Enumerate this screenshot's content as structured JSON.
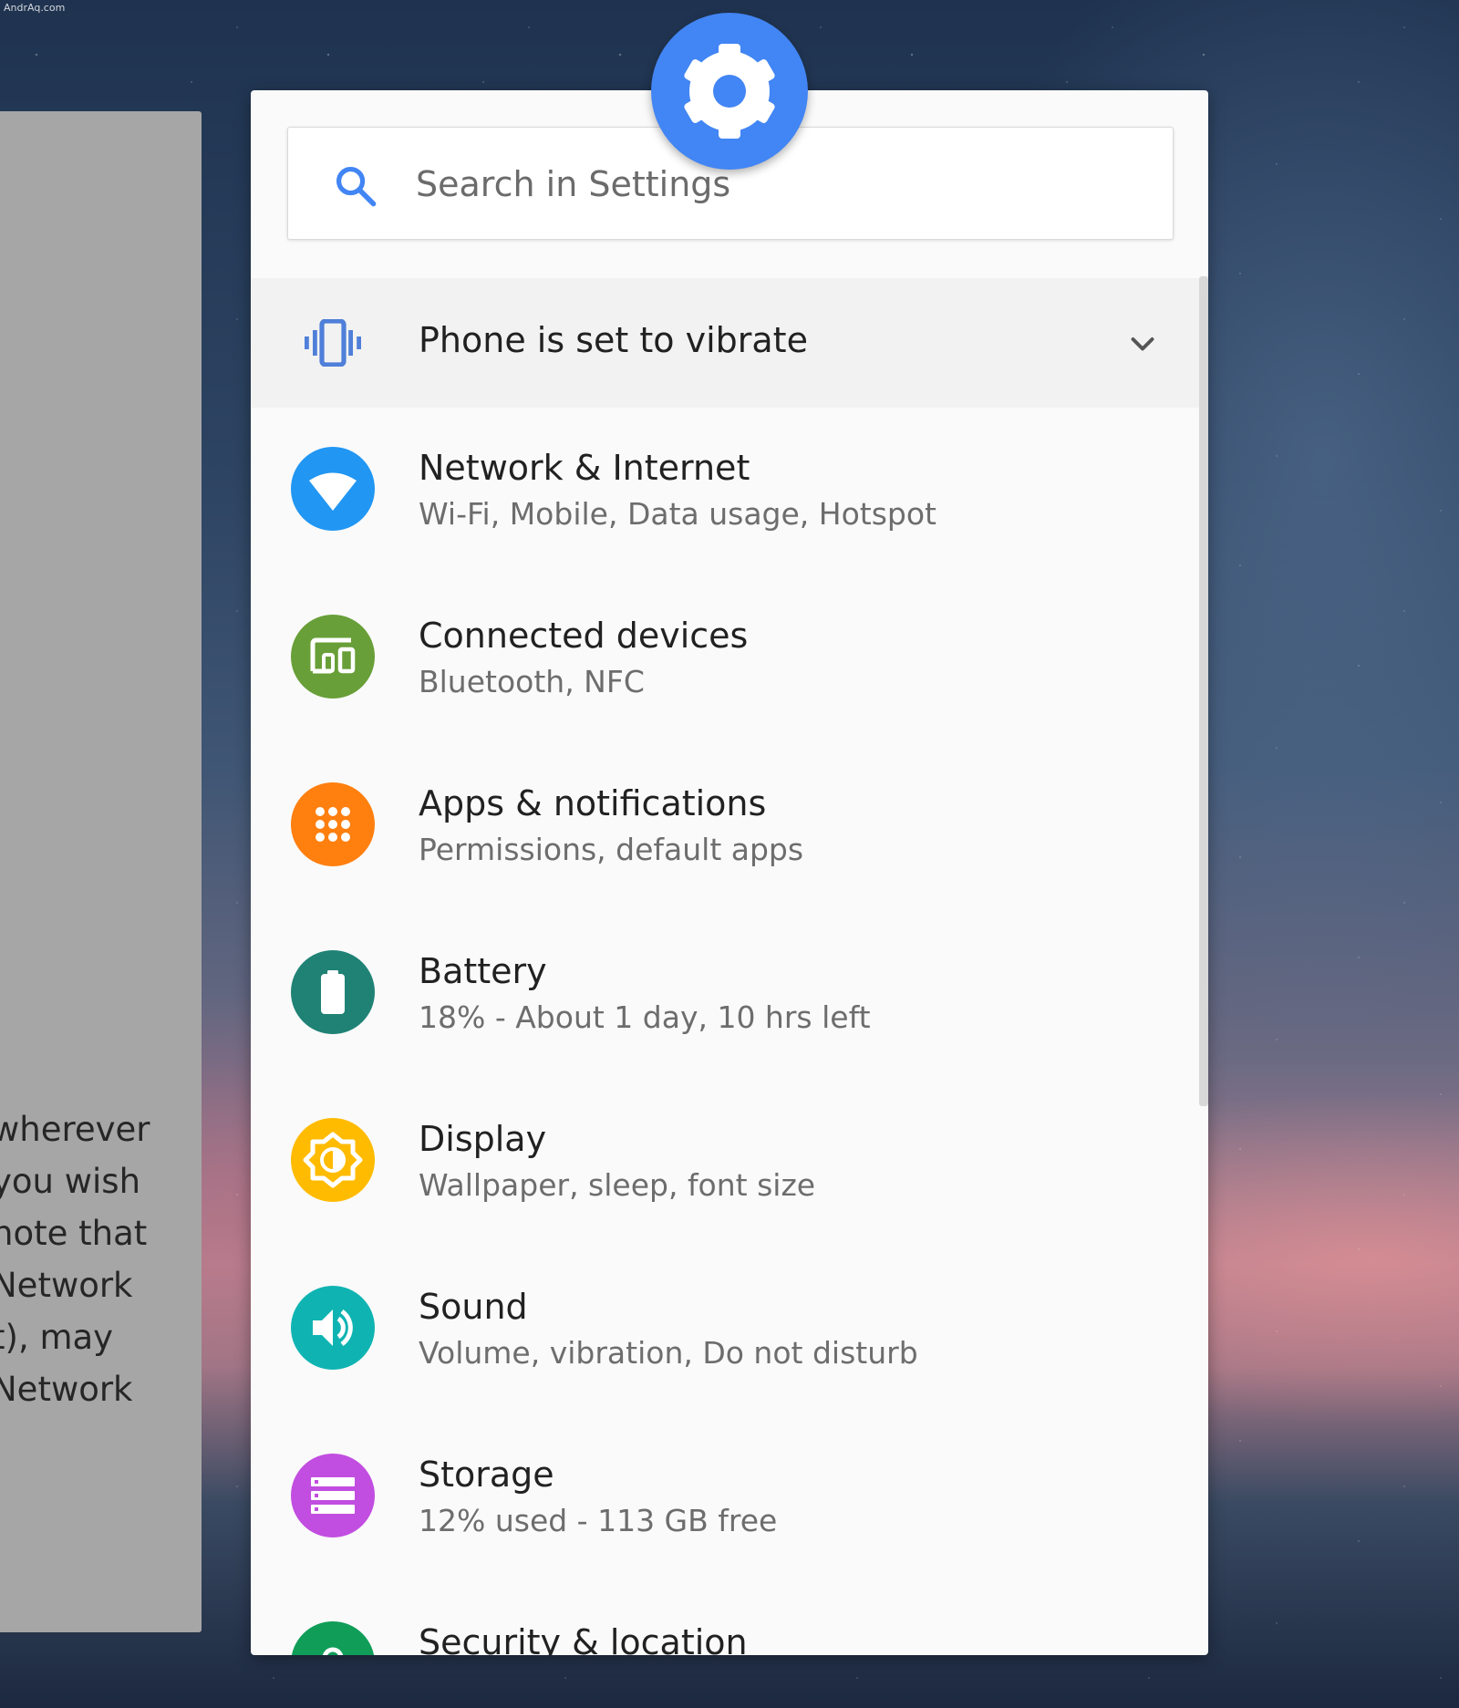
{
  "watermark": "AndrAq.com",
  "background_card": {
    "lines": [
      "wherever",
      "you wish",
      "note that",
      "Network",
      "t), may",
      "Network"
    ]
  },
  "search": {
    "placeholder": "Search in Settings"
  },
  "condition": {
    "label": "Phone is set to vibrate"
  },
  "items": [
    {
      "title": "Network & Internet",
      "subtitle": "Wi-Fi, Mobile, Data usage, Hotspot",
      "color": "#2196f3",
      "icon": "wifi-icon"
    },
    {
      "title": "Connected devices",
      "subtitle": "Bluetooth, NFC",
      "color": "#689f38",
      "icon": "devices-icon"
    },
    {
      "title": "Apps & notifications",
      "subtitle": "Permissions, default apps",
      "color": "#ff7f0f",
      "icon": "apps-icon"
    },
    {
      "title": "Battery",
      "subtitle": "18% - About 1 day, 10 hrs left",
      "color": "#1f8275",
      "icon": "battery-icon"
    },
    {
      "title": "Display",
      "subtitle": "Wallpaper, sleep, font size",
      "color": "#ffbb00",
      "icon": "brightness-icon"
    },
    {
      "title": "Sound",
      "subtitle": "Volume, vibration, Do not disturb",
      "color": "#0fb4b2",
      "icon": "volume-icon"
    },
    {
      "title": "Storage",
      "subtitle": "12% used - 113 GB free",
      "color": "#c14ee0",
      "icon": "storage-icon"
    },
    {
      "title": "Security & location",
      "subtitle": "",
      "color": "#0f9d58",
      "icon": "lock-icon"
    }
  ],
  "colors": {
    "accent": "#4285f4",
    "condition_icon": "#4f7fd9"
  }
}
